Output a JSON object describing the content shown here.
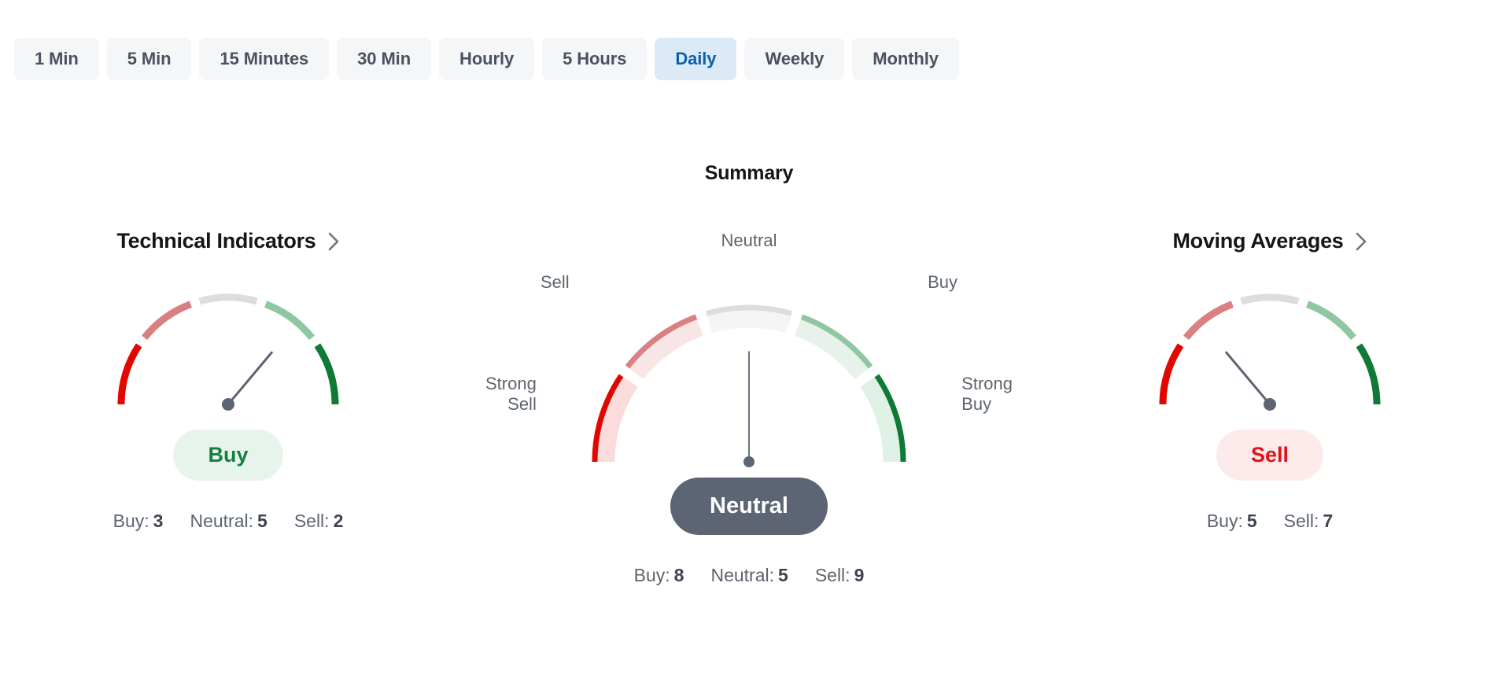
{
  "timeframes": {
    "items": [
      {
        "label": "1 Min",
        "active": false
      },
      {
        "label": "5 Min",
        "active": false
      },
      {
        "label": "15 Minutes",
        "active": false
      },
      {
        "label": "30 Min",
        "active": false
      },
      {
        "label": "Hourly",
        "active": false
      },
      {
        "label": "5 Hours",
        "active": false
      },
      {
        "label": "Daily",
        "active": true
      },
      {
        "label": "Weekly",
        "active": false
      },
      {
        "label": "Monthly",
        "active": false
      }
    ]
  },
  "summary": {
    "title": "Summary"
  },
  "colors": {
    "strong_sell": "#e10600",
    "sell": "#d98080",
    "neutral": "#dddddd",
    "buy": "#8fc7a2",
    "strong_buy": "#0f7a35",
    "accent_blue": "#0b62ab",
    "tab_bg": "#f5f6f7",
    "tab_active_bg": "#dceaf7",
    "needle": "#5d6473",
    "pill_neutral_bg": "#5d6473",
    "pill_buy_bg": "#e7f4ec",
    "pill_buy_text": "#17803d",
    "pill_sell_bg": "#fdeaea",
    "pill_sell_text": "#e2121a"
  },
  "panels": {
    "technical_indicators": {
      "title": "Technical Indicators",
      "chevron_icon": "chevron-right-icon",
      "verdict": "Buy",
      "verdict_style": "buy",
      "gauge": {
        "needle_angle_deg": 40,
        "zone": "Buy"
      },
      "counts": [
        {
          "label": "Buy:",
          "value": "3"
        },
        {
          "label": "Neutral:",
          "value": "5"
        },
        {
          "label": "Sell:",
          "value": "2"
        }
      ]
    },
    "center": {
      "verdict": "Neutral",
      "verdict_style": "neutral",
      "gauge": {
        "needle_angle_deg": 0,
        "zone": "Neutral"
      },
      "ring_labels": {
        "strong_sell": "Strong\nSell",
        "sell": "Sell",
        "neutral": "Neutral",
        "buy": "Buy",
        "strong_buy": "Strong\nBuy"
      },
      "counts": [
        {
          "label": "Buy:",
          "value": "8"
        },
        {
          "label": "Neutral:",
          "value": "5"
        },
        {
          "label": "Sell:",
          "value": "9"
        }
      ]
    },
    "moving_averages": {
      "title": "Moving Averages",
      "chevron_icon": "chevron-right-icon",
      "verdict": "Sell",
      "verdict_style": "sell",
      "gauge": {
        "needle_angle_deg": -40,
        "zone": "Sell"
      },
      "counts": [
        {
          "label": "Buy:",
          "value": "5"
        },
        {
          "label": "Sell:",
          "value": "7"
        }
      ]
    }
  },
  "chart_data": {
    "type": "gauge",
    "title": "Summary",
    "zones": [
      "Strong Sell",
      "Sell",
      "Neutral",
      "Buy",
      "Strong Buy"
    ],
    "zone_colors": [
      "#e10600",
      "#d98080",
      "#dddddd",
      "#8fc7a2",
      "#0f7a35"
    ],
    "gauges": [
      {
        "name": "Technical Indicators",
        "verdict": "Buy",
        "needle_angle_deg": 40,
        "counts": {
          "Buy": 3,
          "Neutral": 5,
          "Sell": 2
        }
      },
      {
        "name": "Summary",
        "verdict": "Neutral",
        "needle_angle_deg": 0,
        "counts": {
          "Buy": 8,
          "Neutral": 5,
          "Sell": 9
        }
      },
      {
        "name": "Moving Averages",
        "verdict": "Sell",
        "needle_angle_deg": -40,
        "counts": {
          "Buy": 5,
          "Sell": 7
        }
      }
    ]
  }
}
